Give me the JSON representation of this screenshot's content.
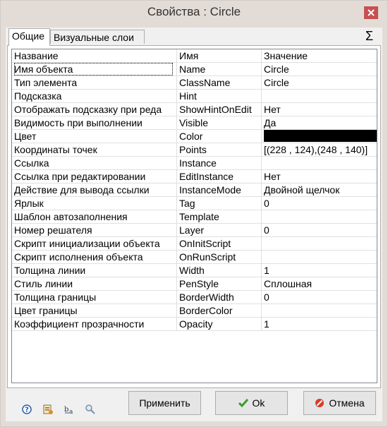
{
  "window": {
    "title": "Свойства : Circle"
  },
  "tabs": [
    {
      "label": "Общие"
    },
    {
      "label": "Визуальные слои"
    }
  ],
  "sigma_symbol": "Σ",
  "grid": {
    "headers": [
      "Название",
      "Имя",
      "Значение"
    ],
    "rows": [
      {
        "label": "Имя объекта",
        "name": "Name",
        "value": "Circle"
      },
      {
        "label": "Тип элемента",
        "name": "ClassName",
        "value": "Circle"
      },
      {
        "label": "Подсказка",
        "name": "Hint",
        "value": ""
      },
      {
        "label": "Отображать подсказку при реда",
        "name": "ShowHintOnEdit",
        "value": "Нет"
      },
      {
        "label": "Видимость при выполнении",
        "name": "Visible",
        "value": "Да"
      },
      {
        "label": "Цвет",
        "name": "Color",
        "value": "",
        "swatch": "#000000"
      },
      {
        "label": "Координаты точек",
        "name": "Points",
        "value": "[(228 , 124),(248 , 140)]"
      },
      {
        "label": "Ссылка",
        "name": "Instance",
        "value": ""
      },
      {
        "label": "Ссылка при редактировании",
        "name": "EditInstance",
        "value": "Нет"
      },
      {
        "label": "Действие для вывода ссылки",
        "name": "InstanceMode",
        "value": "Двойной щелчок"
      },
      {
        "label": "Ярлык",
        "name": "Tag",
        "value": "0"
      },
      {
        "label": "Шаблон автозаполнения",
        "name": "Template",
        "value": ""
      },
      {
        "label": "Номер решателя",
        "name": "Layer",
        "value": "0"
      },
      {
        "label": "Скрипт инициализации объекта",
        "name": "OnInitScript",
        "value": ""
      },
      {
        "label": "Скрипт исполнения объекта",
        "name": "OnRunScript",
        "value": ""
      },
      {
        "label": "Толщина линии",
        "name": "Width",
        "value": "1"
      },
      {
        "label": "Стиль линии",
        "name": "PenStyle",
        "value": "Сплошная"
      },
      {
        "label": "Толщина границы",
        "name": "BorderWidth",
        "value": "0"
      },
      {
        "label": "Цвет границы",
        "name": "BorderColor",
        "value": ""
      },
      {
        "label": "Коэффициент прозрачности",
        "name": "Opacity",
        "value": "1"
      }
    ]
  },
  "toolbar_icons": [
    "help-icon",
    "properties-icon",
    "font-rename-icon",
    "zoom-icon"
  ],
  "buttons": {
    "apply": "Применить",
    "ok": "Ok",
    "cancel": "Отмена"
  },
  "colors": {
    "ok_check": "#3c9a2c",
    "cancel_icon": "#d83b2b",
    "help_icon": "#2a5db0"
  }
}
